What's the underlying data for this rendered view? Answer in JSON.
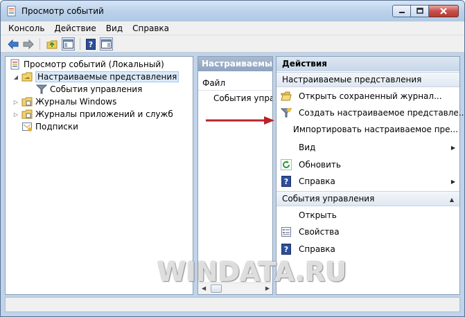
{
  "window": {
    "title": "Просмотр событий"
  },
  "menu": [
    "Консоль",
    "Действие",
    "Вид",
    "Справка"
  ],
  "tree": {
    "root": "Просмотр событий (Локальный)",
    "custom_views": "Настраиваемые представления",
    "admin_events": "События управления",
    "windows_logs": "Журналы Windows",
    "app_logs": "Журналы приложений и служб",
    "subscriptions": "Подписки"
  },
  "middle": {
    "header": "Настраиваемые представления",
    "column": "Файл",
    "row": "События управления"
  },
  "actions": {
    "header": "Действия",
    "section1": {
      "title": "Настраиваемые представления",
      "items": [
        {
          "label": "Открыть сохраненный журнал...",
          "icon": "folder-open-icon"
        },
        {
          "label": "Создать настраиваемое представле...",
          "icon": "filter-icon"
        },
        {
          "label": "Импортировать настраиваемое пре...",
          "icon": "none"
        },
        {
          "label": "Вид",
          "icon": "none",
          "submenu": true
        },
        {
          "label": "Обновить",
          "icon": "refresh-icon"
        },
        {
          "label": "Справка",
          "icon": "help-icon",
          "submenu": true
        }
      ]
    },
    "section2": {
      "title": "События управления",
      "items": [
        {
          "label": "Открыть",
          "icon": "none"
        },
        {
          "label": "Свойства",
          "icon": "properties-icon"
        },
        {
          "label": "Справка",
          "icon": "help-icon"
        }
      ]
    }
  },
  "watermark": "WINDATA.RU",
  "colors": {
    "accent_arrow": "#b8222a",
    "pane_header": "#8ea3be"
  }
}
